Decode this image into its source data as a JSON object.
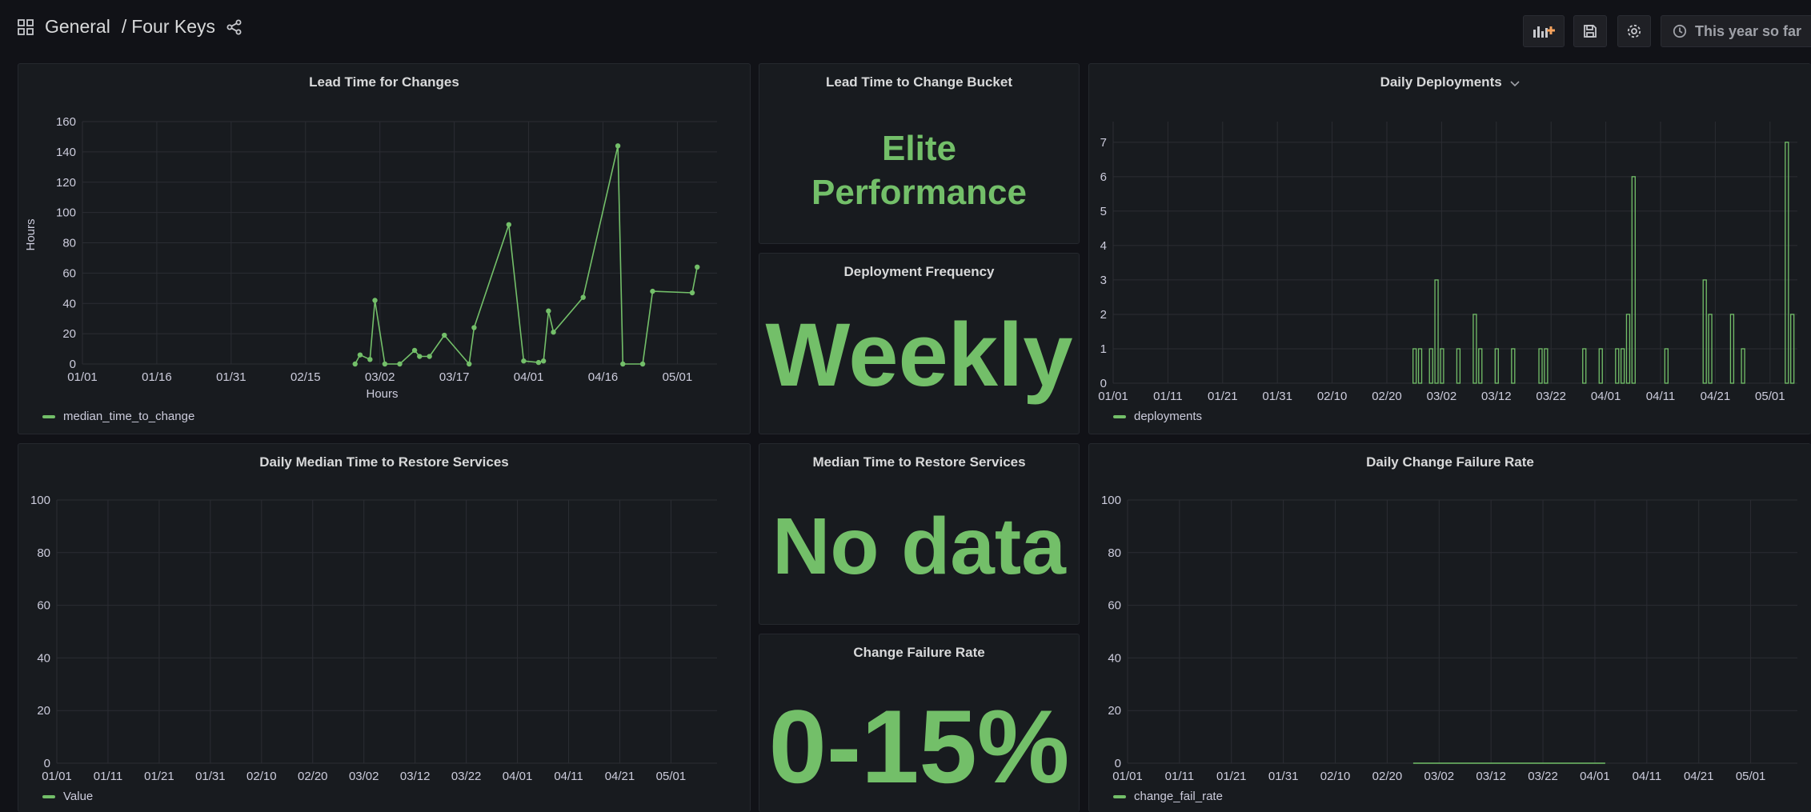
{
  "header": {
    "folder": "General",
    "separator": "/",
    "dashboard": "Four Keys",
    "time_range": "This year so far",
    "icons": [
      "apps-icon",
      "share-icon",
      "add-panel-icon",
      "save-icon",
      "settings-icon",
      "clock-icon"
    ]
  },
  "colors": {
    "series": "#73bf69",
    "background": "#111217",
    "panel": "#181b1f",
    "grid": "#2b2d33"
  },
  "panels": {
    "lead_time": {
      "title": "Lead Time for Changes",
      "legend": "median_time_to_change"
    },
    "bucket": {
      "title": "Lead Time to Change Bucket",
      "line1": "Elite",
      "line2": "Performance"
    },
    "frequency": {
      "title": "Deployment Frequency",
      "value": "Weekly"
    },
    "deployments": {
      "title": "Daily Deployments",
      "legend": "deployments"
    },
    "restore": {
      "title": "Daily Median Time to Restore Services",
      "legend": "Value"
    },
    "restore_stat": {
      "title": "Median Time to Restore Services",
      "value": "No data"
    },
    "cfr_stat": {
      "title": "Change Failure Rate",
      "value": "0-15%"
    },
    "cfr": {
      "title": "Daily Change Failure Rate",
      "legend": "change_fail_rate"
    }
  },
  "chart_data": [
    {
      "id": "lead_time",
      "type": "line",
      "title": "Lead Time for Changes",
      "xlabel": "Hours",
      "ylabel": "Hours",
      "xlim": [
        "01/01",
        "05/09"
      ],
      "ylim": [
        0,
        160
      ],
      "x_ticks": [
        "01/01",
        "01/16",
        "01/31",
        "02/15",
        "03/02",
        "03/17",
        "04/01",
        "04/16",
        "05/01"
      ],
      "y_ticks": [
        0,
        20,
        40,
        60,
        80,
        100,
        120,
        140,
        160
      ],
      "grid": true,
      "legend_position": "bottom-left",
      "series": [
        {
          "name": "median_time_to_change",
          "points": [
            [
              "02/25",
              0
            ],
            [
              "02/26",
              6
            ],
            [
              "02/28",
              3
            ],
            [
              "03/01",
              42
            ],
            [
              "03/03",
              0
            ],
            [
              "03/06",
              0
            ],
            [
              "03/09",
              9
            ],
            [
              "03/10",
              5
            ],
            [
              "03/12",
              5
            ],
            [
              "03/15",
              19
            ],
            [
              "03/20",
              0
            ],
            [
              "03/21",
              24
            ],
            [
              "03/28",
              92
            ],
            [
              "03/31",
              2
            ],
            [
              "04/03",
              1
            ],
            [
              "04/04",
              2
            ],
            [
              "04/05",
              35
            ],
            [
              "04/06",
              21
            ],
            [
              "04/12",
              44
            ],
            [
              "04/19",
              144
            ],
            [
              "04/20",
              0
            ],
            [
              "04/24",
              0
            ],
            [
              "04/26",
              48
            ],
            [
              "05/04",
              47
            ],
            [
              "05/05",
              64
            ]
          ]
        }
      ]
    },
    {
      "id": "deployments",
      "type": "bar",
      "title": "Daily Deployments",
      "xlim": [
        "01/01",
        "05/06"
      ],
      "ylim": [
        0,
        7.6
      ],
      "x_ticks": [
        "01/01",
        "01/11",
        "01/21",
        "01/31",
        "02/10",
        "02/20",
        "03/02",
        "03/12",
        "03/22",
        "04/01",
        "04/11",
        "04/21",
        "05/01"
      ],
      "y_ticks": [
        0,
        1,
        2,
        3,
        4,
        5,
        6,
        7
      ],
      "grid": true,
      "legend_position": "bottom-left",
      "series": [
        {
          "name": "deployments",
          "points": [
            [
              "02/25",
              1
            ],
            [
              "02/26",
              1
            ],
            [
              "02/28",
              1
            ],
            [
              "03/01",
              3
            ],
            [
              "03/02",
              1
            ],
            [
              "03/05",
              1
            ],
            [
              "03/08",
              2
            ],
            [
              "03/09",
              1
            ],
            [
              "03/12",
              1
            ],
            [
              "03/15",
              1
            ],
            [
              "03/20",
              1
            ],
            [
              "03/21",
              1
            ],
            [
              "03/28",
              1
            ],
            [
              "03/31",
              1
            ],
            [
              "04/03",
              1
            ],
            [
              "04/04",
              1
            ],
            [
              "04/05",
              2
            ],
            [
              "04/06",
              6
            ],
            [
              "04/12",
              1
            ],
            [
              "04/19",
              3
            ],
            [
              "04/20",
              2
            ],
            [
              "04/24",
              2
            ],
            [
              "04/26",
              1
            ],
            [
              "05/04",
              7
            ],
            [
              "05/05",
              2
            ]
          ]
        }
      ]
    },
    {
      "id": "restore",
      "type": "line",
      "title": "Daily Median Time to Restore Services",
      "xlim": [
        "01/01",
        "05/10"
      ],
      "ylim": [
        0,
        100
      ],
      "x_ticks": [
        "01/01",
        "01/11",
        "01/21",
        "01/31",
        "02/10",
        "02/20",
        "03/02",
        "03/12",
        "03/22",
        "04/01",
        "04/11",
        "04/21",
        "05/01"
      ],
      "y_ticks": [
        0,
        20,
        40,
        60,
        80,
        100
      ],
      "grid": true,
      "legend_position": "bottom-left",
      "series": [
        {
          "name": "Value",
          "points": []
        }
      ]
    },
    {
      "id": "cfr",
      "type": "line",
      "title": "Daily Change Failure Rate",
      "xlim": [
        "01/01",
        "05/10"
      ],
      "ylim": [
        0,
        100
      ],
      "x_ticks": [
        "01/01",
        "01/11",
        "01/21",
        "01/31",
        "02/10",
        "02/20",
        "03/02",
        "03/12",
        "03/22",
        "04/01",
        "04/11",
        "04/21",
        "05/01"
      ],
      "y_ticks": [
        0,
        20,
        40,
        60,
        80,
        100
      ],
      "grid": true,
      "legend_position": "bottom-left",
      "series": [
        {
          "name": "change_fail_rate",
          "points": [
            [
              "02/25",
              0
            ],
            [
              "04/03",
              0
            ]
          ]
        }
      ]
    }
  ]
}
